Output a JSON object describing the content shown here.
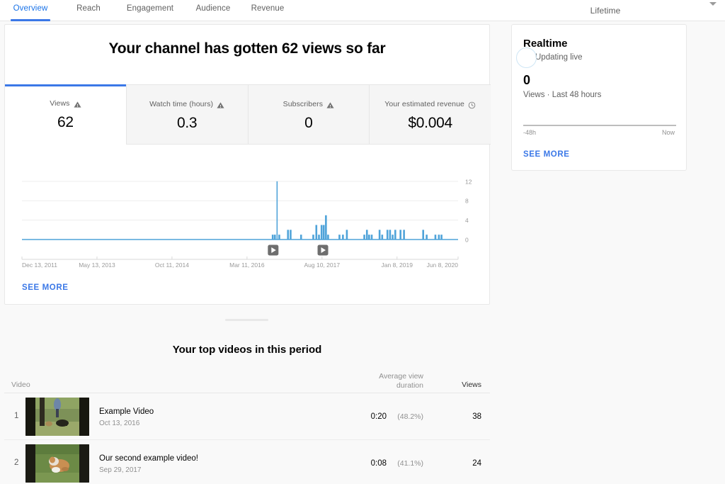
{
  "nav": {
    "tabs": [
      {
        "label": "Overview",
        "active": true
      },
      {
        "label": "Reach",
        "active": false
      },
      {
        "label": "Engagement",
        "active": false
      },
      {
        "label": "Audience",
        "active": false
      },
      {
        "label": "Revenue",
        "active": false
      }
    ],
    "period": {
      "label": "Lifetime",
      "caret_icon": "chevron-down-icon"
    }
  },
  "overview": {
    "headline": "Your channel has gotten 62 views so far",
    "metrics": [
      {
        "label": "Views",
        "value": "62",
        "icon": "warning-triangle-icon",
        "selected": true
      },
      {
        "label": "Watch time (hours)",
        "value": "0.3",
        "icon": "warning-triangle-icon",
        "selected": false
      },
      {
        "label": "Subscribers",
        "value": "0",
        "icon": "warning-triangle-icon",
        "selected": false
      },
      {
        "label": "Your estimated revenue",
        "value": "$0.004",
        "icon": "clock-icon",
        "selected": false
      }
    ],
    "see_more": "SEE MORE"
  },
  "chart_data": {
    "type": "bar",
    "title": "",
    "xlabel": "",
    "ylabel": "",
    "ylim": [
      0,
      13
    ],
    "yticks": [
      0,
      4,
      8,
      12
    ],
    "ytick_labels": [
      "0",
      "4",
      "8",
      "12"
    ],
    "grid": true,
    "accent_color": "#4fa3d9",
    "xtick_labels": [
      "Dec 13, 2011",
      "May 13, 2013",
      "Oct 11, 2014",
      "Mar 11, 2016",
      "Aug 10, 2017",
      "Jan 8, 2019",
      "Jun 8, 2020"
    ],
    "xtick_positions": [
      0,
      0.172,
      0.344,
      0.516,
      0.688,
      0.86,
      1.0
    ],
    "x_range": [
      "Dec 13, 2011",
      "Jun 8, 2020"
    ],
    "markers": [
      {
        "icon": "video-marker-icon",
        "position": 0.576
      },
      {
        "icon": "video-marker-icon",
        "position": 0.69
      }
    ],
    "points": [
      {
        "x": 0.575,
        "y": 1
      },
      {
        "x": 0.58,
        "y": 1
      },
      {
        "x": 0.585,
        "y": 12
      },
      {
        "x": 0.59,
        "y": 1
      },
      {
        "x": 0.6,
        "y": 0
      },
      {
        "x": 0.61,
        "y": 2
      },
      {
        "x": 0.616,
        "y": 2
      },
      {
        "x": 0.625,
        "y": 0
      },
      {
        "x": 0.64,
        "y": 1
      },
      {
        "x": 0.655,
        "y": 0
      },
      {
        "x": 0.668,
        "y": 1
      },
      {
        "x": 0.675,
        "y": 3
      },
      {
        "x": 0.681,
        "y": 1
      },
      {
        "x": 0.687,
        "y": 3
      },
      {
        "x": 0.692,
        "y": 3
      },
      {
        "x": 0.697,
        "y": 5
      },
      {
        "x": 0.702,
        "y": 1
      },
      {
        "x": 0.71,
        "y": 0
      },
      {
        "x": 0.728,
        "y": 1
      },
      {
        "x": 0.736,
        "y": 1
      },
      {
        "x": 0.745,
        "y": 2
      },
      {
        "x": 0.755,
        "y": 0
      },
      {
        "x": 0.785,
        "y": 1
      },
      {
        "x": 0.791,
        "y": 2
      },
      {
        "x": 0.796,
        "y": 1
      },
      {
        "x": 0.802,
        "y": 1
      },
      {
        "x": 0.82,
        "y": 2
      },
      {
        "x": 0.826,
        "y": 1
      },
      {
        "x": 0.838,
        "y": 2
      },
      {
        "x": 0.844,
        "y": 2
      },
      {
        "x": 0.85,
        "y": 1
      },
      {
        "x": 0.856,
        "y": 2
      },
      {
        "x": 0.868,
        "y": 2
      },
      {
        "x": 0.876,
        "y": 2
      },
      {
        "x": 0.89,
        "y": 0
      },
      {
        "x": 0.92,
        "y": 2
      },
      {
        "x": 0.928,
        "y": 1
      },
      {
        "x": 0.948,
        "y": 1
      },
      {
        "x": 0.956,
        "y": 1
      },
      {
        "x": 0.962,
        "y": 1
      }
    ]
  },
  "realtime": {
    "title": "Realtime",
    "live_icon": "live-dot-icon",
    "live_text": "Updating live",
    "value": "0",
    "subtitle": "Views · Last 48 hours",
    "axis_left": "-48h",
    "axis_right": "Now",
    "see_more": "SEE MORE"
  },
  "top_videos": {
    "title": "Your top videos in this period",
    "columns": {
      "video": "Video",
      "avg_view_duration_line1": "Average view",
      "avg_view_duration_line2": "duration",
      "views": "Views"
    },
    "rows": [
      {
        "rank": "1",
        "title": "Example Video",
        "date": "Oct 13, 2016",
        "duration": "0:20",
        "percent": "(48.2%)",
        "views": "38",
        "thumbnail": "outdoor-dog-walk-thumbnail"
      },
      {
        "rank": "2",
        "title": "Our second example video!",
        "date": "Sep 29, 2017",
        "duration": "0:08",
        "percent": "(41.1%)",
        "views": "24",
        "thumbnail": "puppy-on-grass-thumbnail"
      }
    ]
  }
}
